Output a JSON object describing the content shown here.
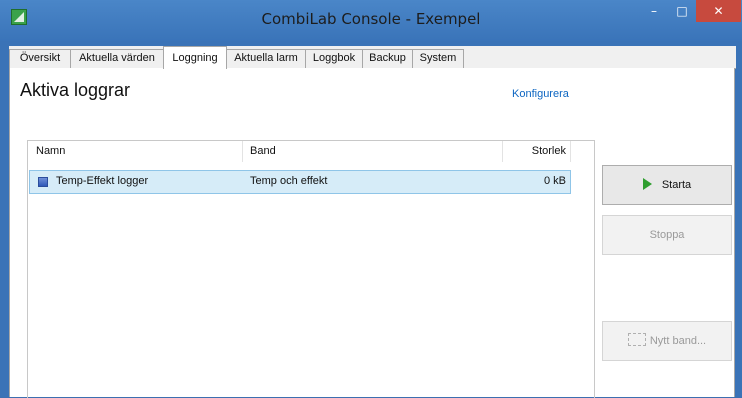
{
  "window": {
    "title": "CombiLab Console - Exempel",
    "minimize_glyph": "–",
    "maximize_glyph": "□",
    "close_glyph": "✕"
  },
  "tabs": [
    {
      "label": "Översikt"
    },
    {
      "label": "Aktuella värden"
    },
    {
      "label": "Loggning",
      "active": true
    },
    {
      "label": "Aktuella larm"
    },
    {
      "label": "Loggbok"
    },
    {
      "label": "Backup"
    },
    {
      "label": "System"
    }
  ],
  "page": {
    "heading": "Aktiva loggrar",
    "configure_link": "Konfigurera"
  },
  "table": {
    "columns": [
      "Namn",
      "Band",
      "Storlek"
    ],
    "rows": [
      {
        "name": "Temp-Effekt logger",
        "band": "Temp och effekt",
        "size": "0 kB",
        "selected": true
      }
    ]
  },
  "buttons": {
    "start": "Starta",
    "stop": "Stoppa",
    "new_band": "Nytt band..."
  },
  "colors": {
    "titlebar": "#3a74b9",
    "close": "#c74a3e",
    "selection": "#d6ecf8",
    "link": "#0d66c2",
    "play": "#2f9e2f"
  }
}
